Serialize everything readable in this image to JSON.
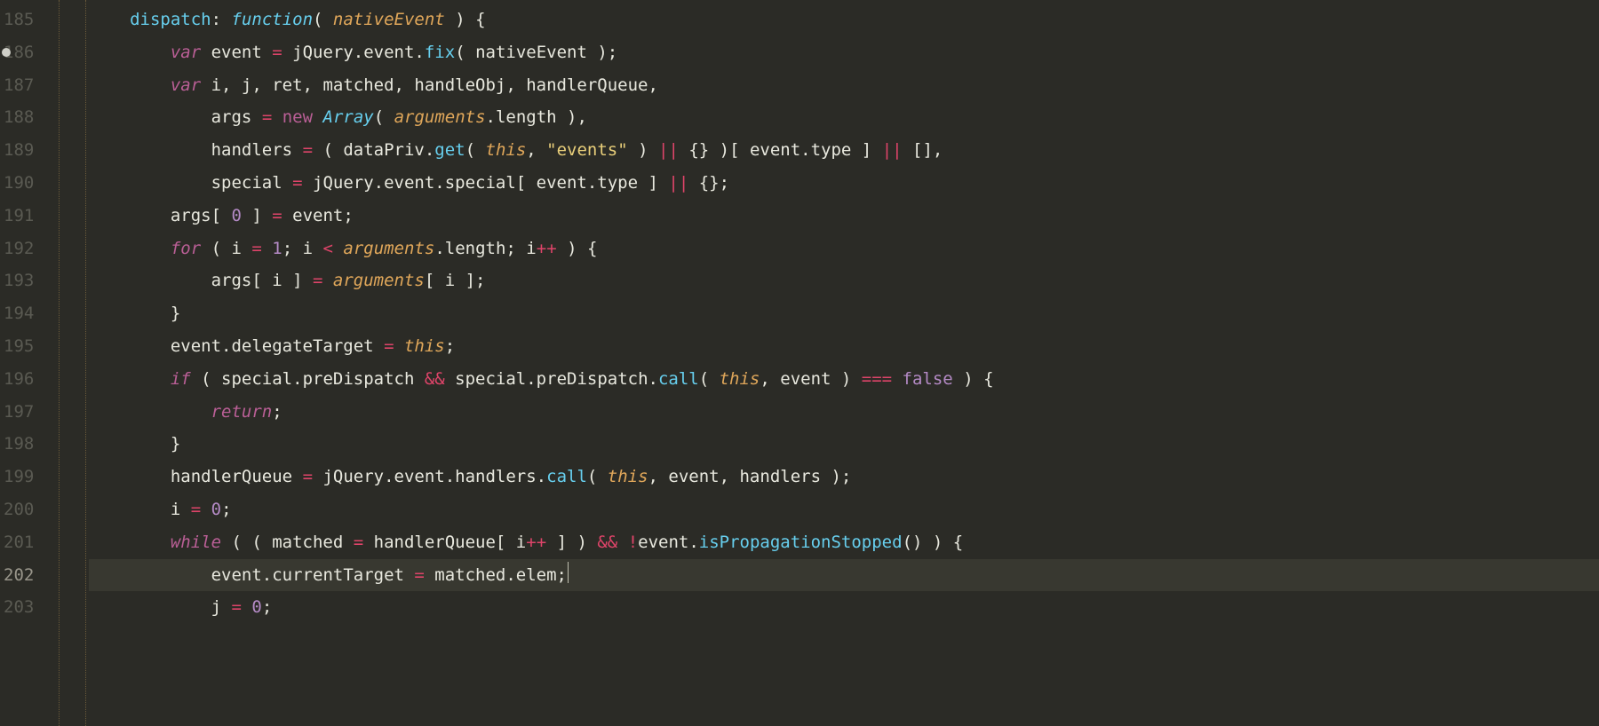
{
  "editor": {
    "first_line_number": 185,
    "modified_line": 186,
    "current_line": 202,
    "lines": [
      {
        "n": 185,
        "tokens": [
          {
            "t": "dispatch",
            "c": "tok-key"
          },
          {
            "t": ": ",
            "c": "tok-plain"
          },
          {
            "t": "function",
            "c": "tok-type"
          },
          {
            "t": "( ",
            "c": "tok-plain"
          },
          {
            "t": "nativeEvent",
            "c": "tok-param"
          },
          {
            "t": " ) {",
            "c": "tok-plain"
          }
        ],
        "indent": 0
      },
      {
        "n": 186,
        "tokens": [
          {
            "t": "var",
            "c": "tok-kw"
          },
          {
            "t": " event ",
            "c": "tok-plain"
          },
          {
            "t": "=",
            "c": "tok-op"
          },
          {
            "t": " jQuery.event.",
            "c": "tok-plain"
          },
          {
            "t": "fix",
            "c": "tok-call"
          },
          {
            "t": "( nativeEvent );",
            "c": "tok-plain"
          }
        ],
        "indent": 1
      },
      {
        "n": 187,
        "tokens": [
          {
            "t": "var",
            "c": "tok-kw"
          },
          {
            "t": " i, j, ret, matched, handleObj, handlerQueue,",
            "c": "tok-plain"
          }
        ],
        "indent": 1
      },
      {
        "n": 188,
        "tokens": [
          {
            "t": "args ",
            "c": "tok-plain"
          },
          {
            "t": "=",
            "c": "tok-op"
          },
          {
            "t": " ",
            "c": "tok-plain"
          },
          {
            "t": "new",
            "c": "tok-kw-ni"
          },
          {
            "t": " ",
            "c": "tok-plain"
          },
          {
            "t": "Array",
            "c": "tok-type"
          },
          {
            "t": "( ",
            "c": "tok-plain"
          },
          {
            "t": "arguments",
            "c": "tok-param"
          },
          {
            "t": ".length ),",
            "c": "tok-plain"
          }
        ],
        "indent": 2
      },
      {
        "n": 189,
        "tokens": [
          {
            "t": "handlers ",
            "c": "tok-plain"
          },
          {
            "t": "=",
            "c": "tok-op"
          },
          {
            "t": " ( dataPriv.",
            "c": "tok-plain"
          },
          {
            "t": "get",
            "c": "tok-call"
          },
          {
            "t": "( ",
            "c": "tok-plain"
          },
          {
            "t": "this",
            "c": "tok-param"
          },
          {
            "t": ", ",
            "c": "tok-plain"
          },
          {
            "t": "\"events\"",
            "c": "tok-str"
          },
          {
            "t": " ) ",
            "c": "tok-plain"
          },
          {
            "t": "||",
            "c": "tok-op"
          },
          {
            "t": " {} )[ event.type ] ",
            "c": "tok-plain"
          },
          {
            "t": "||",
            "c": "tok-op"
          },
          {
            "t": " [],",
            "c": "tok-plain"
          }
        ],
        "indent": 2
      },
      {
        "n": 190,
        "tokens": [
          {
            "t": "special ",
            "c": "tok-plain"
          },
          {
            "t": "=",
            "c": "tok-op"
          },
          {
            "t": " jQuery.event.special[ event.type ] ",
            "c": "tok-plain"
          },
          {
            "t": "||",
            "c": "tok-op"
          },
          {
            "t": " {};",
            "c": "tok-plain"
          }
        ],
        "indent": 2
      },
      {
        "n": 191,
        "tokens": [
          {
            "t": "args[ ",
            "c": "tok-plain"
          },
          {
            "t": "0",
            "c": "tok-num"
          },
          {
            "t": " ] ",
            "c": "tok-plain"
          },
          {
            "t": "=",
            "c": "tok-op"
          },
          {
            "t": " event;",
            "c": "tok-plain"
          }
        ],
        "indent": 1
      },
      {
        "n": 192,
        "tokens": [
          {
            "t": "for",
            "c": "tok-kw"
          },
          {
            "t": " ( i ",
            "c": "tok-plain"
          },
          {
            "t": "=",
            "c": "tok-op"
          },
          {
            "t": " ",
            "c": "tok-plain"
          },
          {
            "t": "1",
            "c": "tok-num"
          },
          {
            "t": "; i ",
            "c": "tok-plain"
          },
          {
            "t": "<",
            "c": "tok-op"
          },
          {
            "t": " ",
            "c": "tok-plain"
          },
          {
            "t": "arguments",
            "c": "tok-param"
          },
          {
            "t": ".length; i",
            "c": "tok-plain"
          },
          {
            "t": "++",
            "c": "tok-op"
          },
          {
            "t": " ) {",
            "c": "tok-plain"
          }
        ],
        "indent": 1
      },
      {
        "n": 193,
        "tokens": [
          {
            "t": "args[ i ] ",
            "c": "tok-plain"
          },
          {
            "t": "=",
            "c": "tok-op"
          },
          {
            "t": " ",
            "c": "tok-plain"
          },
          {
            "t": "arguments",
            "c": "tok-param"
          },
          {
            "t": "[ i ];",
            "c": "tok-plain"
          }
        ],
        "indent": 2
      },
      {
        "n": 194,
        "tokens": [
          {
            "t": "}",
            "c": "tok-plain"
          }
        ],
        "indent": 1
      },
      {
        "n": 195,
        "tokens": [
          {
            "t": "event.delegateTarget ",
            "c": "tok-plain"
          },
          {
            "t": "=",
            "c": "tok-op"
          },
          {
            "t": " ",
            "c": "tok-plain"
          },
          {
            "t": "this",
            "c": "tok-param"
          },
          {
            "t": ";",
            "c": "tok-plain"
          }
        ],
        "indent": 1
      },
      {
        "n": 196,
        "tokens": [
          {
            "t": "if",
            "c": "tok-kw"
          },
          {
            "t": " ( special.preDispatch ",
            "c": "tok-plain"
          },
          {
            "t": "&&",
            "c": "tok-op"
          },
          {
            "t": " special.preDispatch.",
            "c": "tok-plain"
          },
          {
            "t": "call",
            "c": "tok-call"
          },
          {
            "t": "( ",
            "c": "tok-plain"
          },
          {
            "t": "this",
            "c": "tok-param"
          },
          {
            "t": ", event ) ",
            "c": "tok-plain"
          },
          {
            "t": "===",
            "c": "tok-op"
          },
          {
            "t": " ",
            "c": "tok-plain"
          },
          {
            "t": "false",
            "c": "tok-bool"
          },
          {
            "t": " ) {",
            "c": "tok-plain"
          }
        ],
        "indent": 1
      },
      {
        "n": 197,
        "tokens": [
          {
            "t": "return",
            "c": "tok-kw"
          },
          {
            "t": ";",
            "c": "tok-plain"
          }
        ],
        "indent": 2
      },
      {
        "n": 198,
        "tokens": [
          {
            "t": "}",
            "c": "tok-plain"
          }
        ],
        "indent": 1
      },
      {
        "n": 199,
        "tokens": [
          {
            "t": "handlerQueue ",
            "c": "tok-plain"
          },
          {
            "t": "=",
            "c": "tok-op"
          },
          {
            "t": " jQuery.event.handlers.",
            "c": "tok-plain"
          },
          {
            "t": "call",
            "c": "tok-call"
          },
          {
            "t": "( ",
            "c": "tok-plain"
          },
          {
            "t": "this",
            "c": "tok-param"
          },
          {
            "t": ", event, handlers );",
            "c": "tok-plain"
          }
        ],
        "indent": 1
      },
      {
        "n": 200,
        "tokens": [
          {
            "t": "i ",
            "c": "tok-plain"
          },
          {
            "t": "=",
            "c": "tok-op"
          },
          {
            "t": " ",
            "c": "tok-plain"
          },
          {
            "t": "0",
            "c": "tok-num"
          },
          {
            "t": ";",
            "c": "tok-plain"
          }
        ],
        "indent": 1
      },
      {
        "n": 201,
        "tokens": [
          {
            "t": "while",
            "c": "tok-kw"
          },
          {
            "t": " ( ( matched ",
            "c": "tok-plain"
          },
          {
            "t": "=",
            "c": "tok-op"
          },
          {
            "t": " handlerQueue[ i",
            "c": "tok-plain"
          },
          {
            "t": "++",
            "c": "tok-op"
          },
          {
            "t": " ] ) ",
            "c": "tok-plain"
          },
          {
            "t": "&&",
            "c": "tok-op"
          },
          {
            "t": " ",
            "c": "tok-plain"
          },
          {
            "t": "!",
            "c": "tok-op"
          },
          {
            "t": "event.",
            "c": "tok-plain"
          },
          {
            "t": "isPropagationStopped",
            "c": "tok-call"
          },
          {
            "t": "() ) {",
            "c": "tok-plain"
          }
        ],
        "indent": 1
      },
      {
        "n": 202,
        "tokens": [
          {
            "t": "event.currentTarget ",
            "c": "tok-plain"
          },
          {
            "t": "=",
            "c": "tok-op"
          },
          {
            "t": " matched.elem;",
            "c": "tok-plain"
          }
        ],
        "indent": 2,
        "cursor": true
      },
      {
        "n": 203,
        "tokens": [
          {
            "t": "j ",
            "c": "tok-plain"
          },
          {
            "t": "=",
            "c": "tok-op"
          },
          {
            "t": " ",
            "c": "tok-plain"
          },
          {
            "t": "0",
            "c": "tok-num"
          },
          {
            "t": ";",
            "c": "tok-plain"
          }
        ],
        "indent": 2
      }
    ]
  }
}
